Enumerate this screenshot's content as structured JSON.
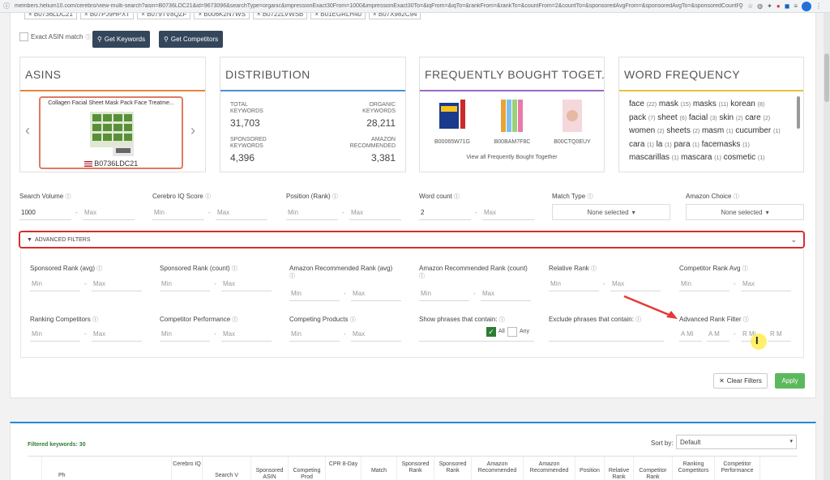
{
  "browser": {
    "url": "members.helium10.com/cerebro/view-multi-search?asin=B0736LDC21&id=9673096&searchType=organic&impressionExact30From=1000&impressionExact30To=&iqFrom=&iqTo=&rankFrom=&rankTo=&countFrom=2&countTo=&sponsoredAvgFrom=&sponsoredAvgTo=&sponsoredCountF...",
    "profile_initial": "S"
  },
  "chips": [
    "× B0736LDC21",
    "× B07PJ9HPXT",
    "× B079TV8QZF",
    "× B006K2N7WS",
    "× B0722LVWSB",
    "× B01EGRLH40",
    "× B07X982C94"
  ],
  "toolbar": {
    "exact_label": "Exact ASIN match",
    "get_keywords": "Get Keywords",
    "get_competitors": "Get Competitors"
  },
  "panels": {
    "asins": {
      "title": "ASINS",
      "product_name": "Collagen Facial Sheet Mask Pack Face Treatme...",
      "asin": "B0736LDC21"
    },
    "distribution": {
      "title": "DISTRIBUTION",
      "total_label": "TOTAL KEYWORDS",
      "total_value": "31,703",
      "organic_label": "ORGANIC KEYWORDS",
      "organic_value": "28,211",
      "sponsored_label": "SPONSORED KEYWORDS",
      "sponsored_value": "4,396",
      "amazon_label": "AMAZON RECOMMENDED",
      "amazon_value": "3,381"
    },
    "fbt": {
      "title": "FREQUENTLY BOUGHT TOGET...",
      "items": [
        "B00065W71G",
        "B00BAM7F8C",
        "B00CTQ0EUY"
      ],
      "link": "View all Frequently Bought Together"
    },
    "word_frequency": {
      "title": "WORD FREQUENCY",
      "words": [
        {
          "w": "face",
          "c": "(22)"
        },
        {
          "w": "mask",
          "c": "(15)"
        },
        {
          "w": "masks",
          "c": "(11)"
        },
        {
          "w": "korean",
          "c": "(8)"
        },
        {
          "w": "pack",
          "c": "(7)"
        },
        {
          "w": "sheet",
          "c": "(6)"
        },
        {
          "w": "facial",
          "c": "(3)"
        },
        {
          "w": "skin",
          "c": "(2)"
        },
        {
          "w": "care",
          "c": "(2)"
        },
        {
          "w": "women",
          "c": "(2)"
        },
        {
          "w": "sheets",
          "c": "(2)"
        },
        {
          "w": "masm",
          "c": "(1)"
        },
        {
          "w": "cucumber",
          "c": "(1)"
        },
        {
          "w": "cara",
          "c": "(1)"
        },
        {
          "w": "la",
          "c": "(1)"
        },
        {
          "w": "para",
          "c": "(1)"
        },
        {
          "w": "facemasks",
          "c": "(1)"
        },
        {
          "w": "mascarillas",
          "c": "(1)"
        },
        {
          "w": "mascara",
          "c": "(1)"
        },
        {
          "w": "cosmetic",
          "c": "(1)"
        }
      ]
    }
  },
  "filters": {
    "search_volume": {
      "label": "Search Volume",
      "min": "1000",
      "max": "Max"
    },
    "cerebro_iq": {
      "label": "Cerebro IQ Score",
      "min": "Min",
      "max": "Max"
    },
    "position": {
      "label": "Position (Rank)",
      "min": "Min",
      "max": "Max"
    },
    "word_count": {
      "label": "Word count",
      "min": "2",
      "max": "Max"
    },
    "match_type": {
      "label": "Match Type",
      "value": "None selected"
    },
    "amazon_choice": {
      "label": "Amazon Choice",
      "value": "None selected"
    },
    "min_ph": "Min",
    "max_ph": "Max",
    "dash": "-"
  },
  "advanced": {
    "bar_label": "ADVANCED FILTERS",
    "sponsored_rank_avg": "Sponsored Rank (avg)",
    "sponsored_rank_count": "Sponsored Rank (count)",
    "amazon_rec_rank_avg": "Amazon Recommended Rank (avg)",
    "amazon_rec_rank_count": "Amazon Recommended Rank (count)",
    "relative_rank": "Relative Rank",
    "competitor_rank_avg": "Competitor Rank Avg",
    "ranking_competitors": "Ranking Competitors",
    "competitor_performance": "Competitor Performance",
    "competing_products": "Competing Products",
    "show_phrases": "Show phrases that contain:",
    "exclude_phrases": "Exclude phrases that contain:",
    "advanced_rank_filter": "Advanced Rank Filter",
    "all_label": "All",
    "any_label": "Any",
    "a_min": "A Mi",
    "a_max": "A M",
    "r_min": "R Mi",
    "r_max": "R M"
  },
  "actions": {
    "clear_filters": "Clear Filters",
    "apply": "Apply"
  },
  "results": {
    "filtered_keywords": "Filtered keywords: 30",
    "sort_by_label": "Sort by:",
    "sort_by_value": "Default",
    "columns": [
      "",
      "Ph",
      "Cerebro IQ",
      "Search V",
      "Sponsored ASIN",
      "Competing Prod",
      "CPR 8-Day",
      "Match",
      "Sponsored Rank",
      "Sponsored Rank",
      "Amazon Recommended",
      "Amazon Recommended",
      "Position",
      "Relative Rank",
      "Competitor Rank",
      "Ranking Competitors",
      "Competitor Performance"
    ]
  }
}
